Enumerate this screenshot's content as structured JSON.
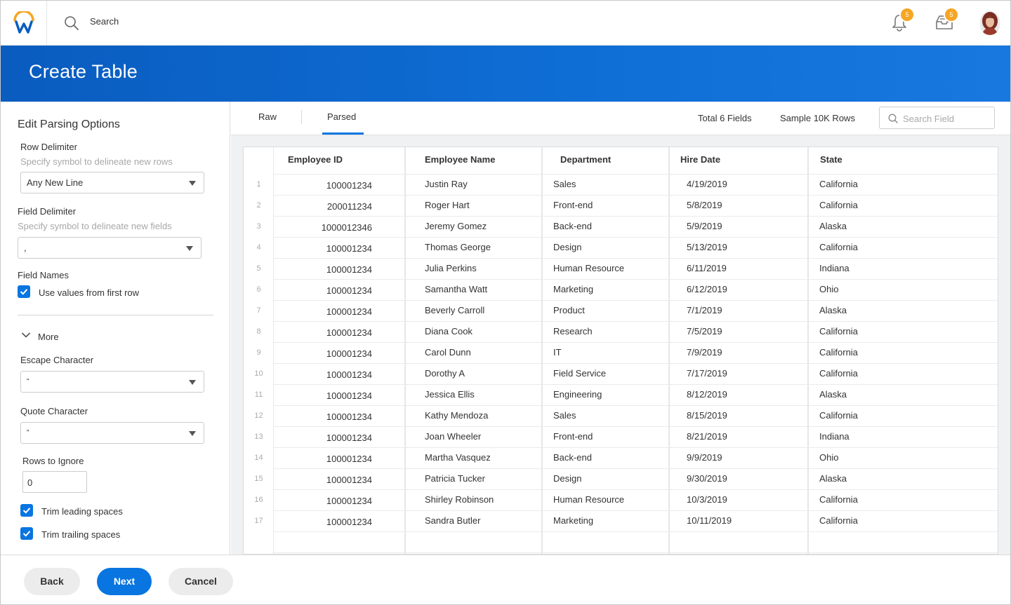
{
  "topbar": {
    "search_label": "Search",
    "notifications_count": "5",
    "inbox_count": "5"
  },
  "header": {
    "title": "Create Table"
  },
  "left_panel": {
    "title": "Edit Parsing Options",
    "row_delimiter": {
      "label": "Row Delimiter",
      "hint": "Specify symbol  to delineate new rows",
      "value": "Any New Line"
    },
    "field_delimiter": {
      "label": "Field  Delimiter",
      "hint": "Specify  symbol  to delineate new fields",
      "value": ","
    },
    "field_names": {
      "label": "Field  Names",
      "checkbox_label": "Use values from first row",
      "checked": true
    },
    "more_label": "More",
    "escape_character": {
      "label": "Escape Character",
      "value": "\""
    },
    "quote_character": {
      "label": "Quote Character",
      "value": "\""
    },
    "rows_to_ignore": {
      "label": "Rows  to Ignore",
      "value": "0"
    },
    "trim_leading": {
      "label": "Trim leading spaces",
      "checked": true
    },
    "trim_trailing": {
      "label": "Trim trailing  spaces",
      "checked": true
    }
  },
  "tabs": {
    "raw": "Raw",
    "parsed": "Parsed",
    "active": "Parsed"
  },
  "info": {
    "total_fields": "Total 6 Fields",
    "sample_rows": "Sample 10K Rows",
    "search_placeholder": "Search Field"
  },
  "table": {
    "headers": [
      "Employee ID",
      "Employee Name",
      "Department",
      "Hire Date",
      "State"
    ],
    "rows": [
      {
        "n": "1",
        "id": "100001234",
        "name": "Justin Ray",
        "dept": "Sales",
        "date": "4/19/2019",
        "state": "California"
      },
      {
        "n": "2",
        "id": "200011234",
        "name": "Roger Hart",
        "dept": "Front-end",
        "date": "5/8/2019",
        "state": "California"
      },
      {
        "n": "3",
        "id": "1000012346",
        "name": "Jeremy Gomez",
        "dept": "Back-end",
        "date": "5/9/2019",
        "state": "Alaska"
      },
      {
        "n": "4",
        "id": "100001234",
        "name": "Thomas George",
        "dept": "Design",
        "date": "5/13/2019",
        "state": "California"
      },
      {
        "n": "5",
        "id": "100001234",
        "name": "Julia Perkins",
        "dept": "Human Resource",
        "date": "6/11/2019",
        "state": "Indiana"
      },
      {
        "n": "6",
        "id": "100001234",
        "name": "Samantha Watt",
        "dept": "Marketing",
        "date": "6/12/2019",
        "state": "Ohio"
      },
      {
        "n": "7",
        "id": "100001234",
        "name": "Beverly Carroll",
        "dept": "Product",
        "date": "7/1/2019",
        "state": "Alaska"
      },
      {
        "n": "8",
        "id": "100001234",
        "name": "Diana Cook",
        "dept": "Research",
        "date": "7/5/2019",
        "state": "California"
      },
      {
        "n": "9",
        "id": "100001234",
        "name": "Carol Dunn",
        "dept": "IT",
        "date": "7/9/2019",
        "state": "California"
      },
      {
        "n": "10",
        "id": "100001234",
        "name": "Dorothy A",
        "dept": "Field Service",
        "date": "7/17/2019",
        "state": "California"
      },
      {
        "n": "11",
        "id": "100001234",
        "name": "Jessica Ellis",
        "dept": "Engineering",
        "date": "8/12/2019",
        "state": "Alaska"
      },
      {
        "n": "12",
        "id": "100001234",
        "name": "Kathy Mendoza",
        "dept": "Sales",
        "date": "8/15/2019",
        "state": "California"
      },
      {
        "n": "13",
        "id": "100001234",
        "name": "Joan Wheeler",
        "dept": "Front-end",
        "date": "8/21/2019",
        "state": "Indiana"
      },
      {
        "n": "14",
        "id": "100001234",
        "name": "Martha Vasquez",
        "dept": "Back-end",
        "date": "9/9/2019",
        "state": "Ohio"
      },
      {
        "n": "15",
        "id": "100001234",
        "name": "Patricia Tucker",
        "dept": "Design",
        "date": "9/30/2019",
        "state": "Alaska"
      },
      {
        "n": "16",
        "id": "100001234",
        "name": "Shirley Robinson",
        "dept": "Human Resource",
        "date": "10/3/2019",
        "state": "California"
      },
      {
        "n": "17",
        "id": "100001234",
        "name": "Sandra Butler",
        "dept": "Marketing",
        "date": "10/11/2019",
        "state": "California"
      }
    ]
  },
  "footer": {
    "back": "Back",
    "next": "Next",
    "cancel": "Cancel"
  },
  "colors": {
    "accent": "#0875e1",
    "header_blue": "#0f6fd6",
    "badge": "#f5a623",
    "logo_orange": "#f5a623"
  }
}
